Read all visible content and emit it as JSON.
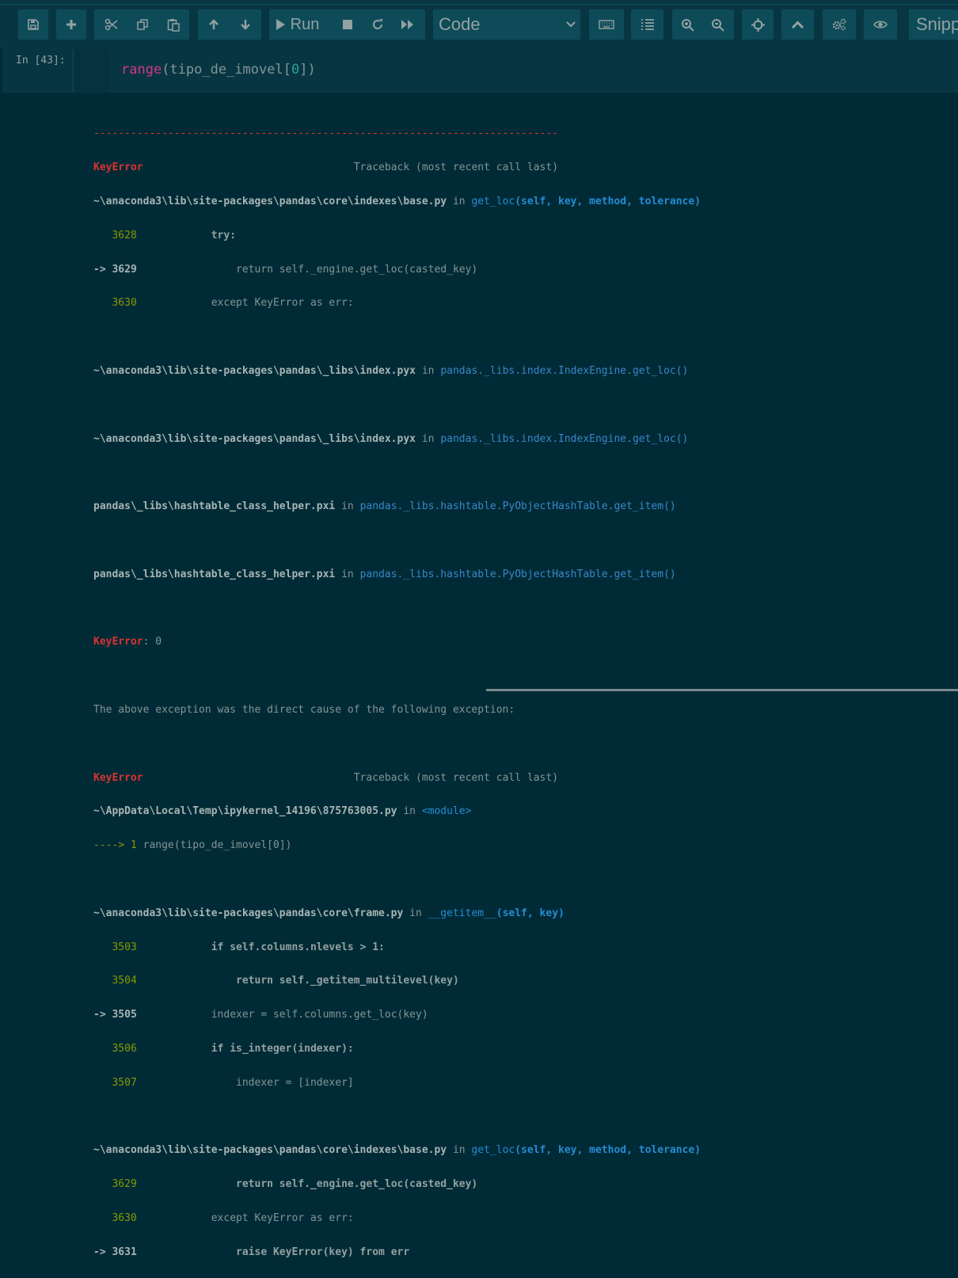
{
  "toolbar": {
    "run_label": "Run",
    "cell_type": "Code",
    "snippets_label": "Snippets",
    "icons": [
      "save-icon",
      "plus-icon",
      "scissors-icon",
      "copy-icon",
      "paste-icon",
      "arrow-up-icon",
      "arrow-down-icon",
      "play-icon",
      "stop-icon",
      "restart-icon",
      "fast-forward-icon",
      "chevron-down-icon",
      "keyboard-icon",
      "list-icon",
      "zoom-in-icon",
      "zoom-out-icon",
      "crosshair-icon",
      "chevron-up-icon",
      "gears-icon",
      "eye-icon"
    ]
  },
  "cell": {
    "prompt": "In [43]:",
    "code": {
      "fn": "range",
      "open": "(tipo_de_imovel[",
      "num": "0",
      "close": "])"
    }
  },
  "output": {
    "dashes": "---------------------------------------------------------------------------",
    "t1": {
      "err": "KeyError",
      "gap": "                                  ",
      "label": "Traceback (most recent call last)"
    },
    "f1": {
      "path": "~\\anaconda3\\lib\\site-packages\\pandas\\core\\indexes\\base.py",
      "in": " in ",
      "fn": "get_loc",
      "args": "(self, key, method, tolerance)"
    },
    "f1_l1": {
      "no": "   3628",
      "code": "            try:"
    },
    "f1_l2": {
      "no": "-> 3629",
      "code": "                return self._engine.get_loc(casted_key)"
    },
    "f1_l3": {
      "no": "   3630",
      "code": "            except KeyError as err:"
    },
    "f2": {
      "path": "~\\anaconda3\\lib\\site-packages\\pandas\\_libs\\index.pyx",
      "in": " in ",
      "fn": "pandas._libs.index.IndexEngine.get_loc()"
    },
    "f3": {
      "path": "~\\anaconda3\\lib\\site-packages\\pandas\\_libs\\index.pyx",
      "in": " in ",
      "fn": "pandas._libs.index.IndexEngine.get_loc()"
    },
    "f4": {
      "path": "pandas\\_libs\\hashtable_class_helper.pxi",
      "in": " in ",
      "fn": "pandas._libs.hashtable.PyObjectHashTable.get_item()"
    },
    "f5": {
      "path": "pandas\\_libs\\hashtable_class_helper.pxi",
      "in": " in ",
      "fn": "pandas._libs.hashtable.PyObjectHashTable.get_item()"
    },
    "err1": {
      "name": "KeyError",
      "msg": ": 0"
    },
    "cause": "The above exception was the direct cause of the following exception:",
    "t2": {
      "err": "KeyError",
      "gap": "                                  ",
      "label": "Traceback (most recent call last)"
    },
    "f6": {
      "path": "~\\AppData\\Local\\Temp\\ipykernel_14196\\875763005.py",
      "in": " in ",
      "fn": "<module>"
    },
    "f6_l1": {
      "arrow": "----> 1 ",
      "code": "range(tipo_de_imovel[0])"
    },
    "f7": {
      "path": "~\\anaconda3\\lib\\site-packages\\pandas\\core\\frame.py",
      "in": " in ",
      "fn": "__getitem__",
      "args": "(self, key)"
    },
    "f7_l1": {
      "no": "   3503",
      "code": "            if self.columns.nlevels > 1:"
    },
    "f7_l2": {
      "no": "   3504",
      "code": "                return self._getitem_multilevel(key)"
    },
    "f7_l3": {
      "no": "-> 3505",
      "code": "            indexer = self.columns.get_loc(key)"
    },
    "f7_l4": {
      "no": "   3506",
      "code": "            if is_integer(indexer):"
    },
    "f7_l5": {
      "no": "   3507",
      "code": "                indexer = [indexer]"
    },
    "f8": {
      "path": "~\\anaconda3\\lib\\site-packages\\pandas\\core\\indexes\\base.py",
      "in": " in ",
      "fn": "get_loc",
      "args": "(self, key, method, tolerance)"
    },
    "f8_l1": {
      "no": "   3629",
      "code": "                return self._engine.get_loc(casted_key)"
    },
    "f8_l2": {
      "no": "   3630",
      "code": "            except KeyError as err:"
    },
    "f8_l3": {
      "no": "-> 3631",
      "code": "                raise KeyError(key) from err"
    }
  }
}
